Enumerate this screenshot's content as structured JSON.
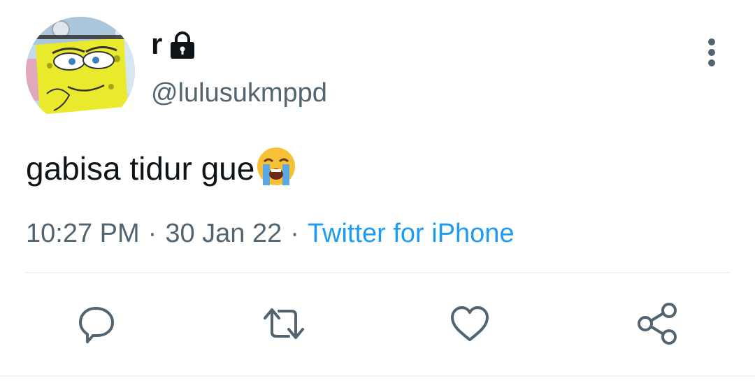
{
  "author": {
    "display_name": "r",
    "handle": "@lulusukmppd",
    "avatar_icon": "spongebob-avatar",
    "protected_icon": "lock-icon"
  },
  "tweet": {
    "text": "gabisa tidur gue",
    "emoji_icon": "loudly-crying-face-emoji"
  },
  "meta": {
    "time": "10:27 PM",
    "separator": "·",
    "date": "30 Jan 22",
    "source": "Twitter for iPhone"
  },
  "actions": {
    "more_icon": "more-vertical-icon",
    "reply_icon": "reply-icon",
    "retweet_icon": "retweet-icon",
    "like_icon": "heart-icon",
    "share_icon": "share-icon"
  },
  "colors": {
    "text_primary": "#0f1419",
    "text_secondary": "#536471",
    "link": "#1d9bf0",
    "divider": "#eff3f4"
  }
}
